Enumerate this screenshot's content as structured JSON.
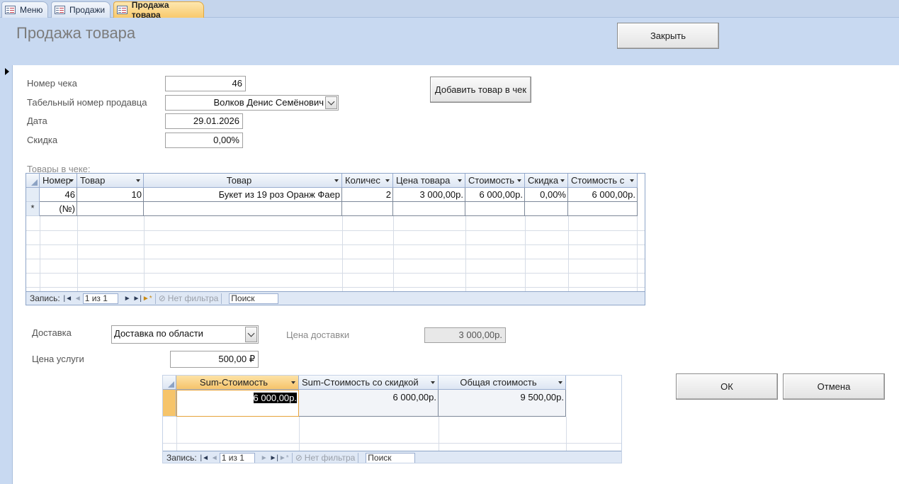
{
  "tabs": [
    {
      "label": "Меню"
    },
    {
      "label": "Продажи"
    },
    {
      "label": "Продажа товара"
    }
  ],
  "header": {
    "title": "Продажа товара",
    "close_label": "Закрыть"
  },
  "fields": {
    "receipt_number": {
      "label": "Номер чека",
      "value": "46"
    },
    "seller": {
      "label": "Табельный номер продавца",
      "value": "Волков Денис Семёнович"
    },
    "date": {
      "label": "Дата",
      "value": "29.01.2026"
    },
    "discount": {
      "label": "Скидка",
      "value": "0,00%"
    }
  },
  "add_item_label": "Добавить товар в чек",
  "items_grid": {
    "caption": "Товары в чеке:",
    "columns": [
      "Номер",
      "Товар",
      "Товар",
      "Количес",
      "Цена товара",
      "Стоимость",
      "Скидка",
      "Стоимость с"
    ],
    "rows": [
      [
        "46",
        "10",
        "Букет из 19 роз Оранж Фаер",
        "2",
        "3 000,00р.",
        "6 000,00р.",
        "0,00%",
        "6 000,00р."
      ]
    ],
    "new_row_marker": "*",
    "new_row_placeholder": "(№)",
    "nav": {
      "record_label": "Запись:",
      "position": "1 из 1",
      "filter": "Нет фильтра",
      "search": "Поиск"
    }
  },
  "delivery": {
    "label": "Доставка",
    "value": "Доставка по области",
    "price_label": "Цена доставки",
    "price_value": "3 000,00р."
  },
  "service": {
    "label": "Цена услуги",
    "value": "500,00 ₽"
  },
  "summary_grid": {
    "columns": [
      "Sum-Стоимость",
      "Sum-Стоимость со скидкой",
      "Общая стоимость"
    ],
    "row": [
      "6 000,00р.",
      "6 000,00р.",
      "9 500,00р."
    ],
    "nav": {
      "record_label": "Запись:",
      "position": "1 из 1",
      "filter": "Нет фильтра",
      "search": "Поиск"
    }
  },
  "buttons": {
    "ok": "ОК",
    "cancel": "Отмена"
  },
  "colors": {
    "header_band": "#c8d9f1",
    "active_tab": "#f8c96c",
    "grid_border": "#8ea5c8"
  }
}
